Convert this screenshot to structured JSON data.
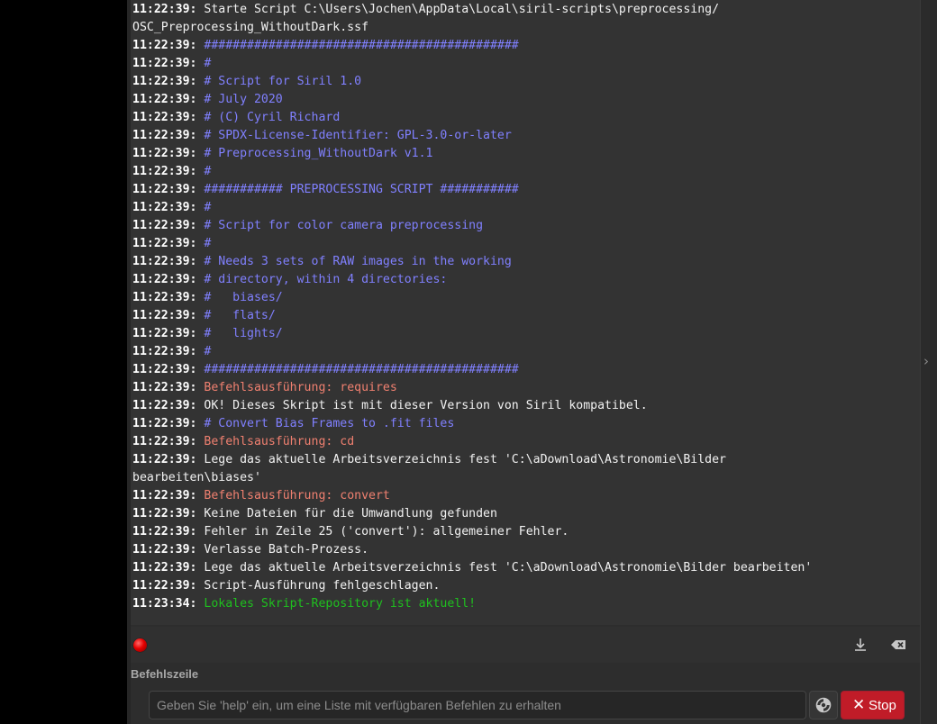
{
  "log": {
    "lines": [
      {
        "time": "11:22:39:",
        "text": " Starte Script C:\\Users\\Jochen\\AppData\\Local\\siril-scripts\\preprocessing/\nOSC_Preprocessing_WithoutDark.ssf",
        "kind": "plain",
        "noTs": false
      },
      {
        "time": "11:22:39:",
        "text": " ############################################",
        "kind": "comment"
      },
      {
        "time": "11:22:39:",
        "text": " #",
        "kind": "comment"
      },
      {
        "time": "11:22:39:",
        "text": " # Script for Siril 1.0",
        "kind": "comment"
      },
      {
        "time": "11:22:39:",
        "text": " # July 2020",
        "kind": "comment"
      },
      {
        "time": "11:22:39:",
        "text": " # (C) Cyril Richard",
        "kind": "comment"
      },
      {
        "time": "11:22:39:",
        "text": " # SPDX-License-Identifier: GPL-3.0-or-later",
        "kind": "comment"
      },
      {
        "time": "11:22:39:",
        "text": " # Preprocessing_WithoutDark v1.1",
        "kind": "comment"
      },
      {
        "time": "11:22:39:",
        "text": " #",
        "kind": "comment"
      },
      {
        "time": "11:22:39:",
        "text": " ########### PREPROCESSING SCRIPT ###########",
        "kind": "comment"
      },
      {
        "time": "11:22:39:",
        "text": " #",
        "kind": "comment"
      },
      {
        "time": "11:22:39:",
        "text": " # Script for color camera preprocessing",
        "kind": "comment"
      },
      {
        "time": "11:22:39:",
        "text": " #",
        "kind": "comment"
      },
      {
        "time": "11:22:39:",
        "text": " # Needs 3 sets of RAW images in the working",
        "kind": "comment"
      },
      {
        "time": "11:22:39:",
        "text": " # directory, within 4 directories:",
        "kind": "comment"
      },
      {
        "time": "11:22:39:",
        "text": " #   biases/",
        "kind": "comment"
      },
      {
        "time": "11:22:39:",
        "text": " #   flats/",
        "kind": "comment"
      },
      {
        "time": "11:22:39:",
        "text": " #   lights/",
        "kind": "comment"
      },
      {
        "time": "11:22:39:",
        "text": " #",
        "kind": "comment"
      },
      {
        "time": "11:22:39:",
        "text": " ############################################",
        "kind": "comment"
      },
      {
        "time": "11:22:39:",
        "text": " Befehlsausführung: requires",
        "kind": "cmd"
      },
      {
        "time": "11:22:39:",
        "text": " OK! Dieses Skript ist mit dieser Version von Siril kompatibel.",
        "kind": "plain"
      },
      {
        "time": "11:22:39:",
        "text": " # Convert Bias Frames to .fit files",
        "kind": "comment"
      },
      {
        "time": "11:22:39:",
        "text": " Befehlsausführung: cd",
        "kind": "cmd"
      },
      {
        "time": "11:22:39:",
        "text": " Lege das aktuelle Arbeitsverzeichnis fest 'C:\\aDownload\\Astronomie\\Bilder\nbearbeiten\\biases'",
        "kind": "plain"
      },
      {
        "time": "11:22:39:",
        "text": " Befehlsausführung: convert",
        "kind": "cmd"
      },
      {
        "time": "11:22:39:",
        "text": " Keine Dateien für die Umwandlung gefunden",
        "kind": "plain"
      },
      {
        "time": "11:22:39:",
        "text": " Fehler in Zeile 25 ('convert'): allgemeiner Fehler.",
        "kind": "plain"
      },
      {
        "time": "11:22:39:",
        "text": " Verlasse Batch-Prozess.",
        "kind": "plain"
      },
      {
        "time": "11:22:39:",
        "text": " Lege das aktuelle Arbeitsverzeichnis fest 'C:\\aDownload\\Astronomie\\Bilder bearbeiten'",
        "kind": "plain"
      },
      {
        "time": "11:22:39:",
        "text": " Script-Ausführung fehlgeschlagen.",
        "kind": "plain"
      },
      {
        "time": "11:23:34:",
        "text": " Lokales Skript-Repository ist aktuell!",
        "kind": "ok"
      }
    ]
  },
  "toolbar": {
    "status_led": "red-status-led",
    "export_icon": "export-log-icon",
    "clear_icon": "clear-log-icon"
  },
  "command_line": {
    "label": "Befehlszeile",
    "placeholder": "Geben Sie 'help' ein, um eine Liste mit verfügbaren Befehlen zu erhalten",
    "value": "",
    "help_icon": "help-lifebuoy-icon",
    "stop_label": "Stop",
    "stop_icon": "stop-x-icon"
  },
  "colors": {
    "comment": "#8080ff",
    "command": "#f08070",
    "success": "#1fc01f",
    "stop_button": "#c01c28"
  }
}
